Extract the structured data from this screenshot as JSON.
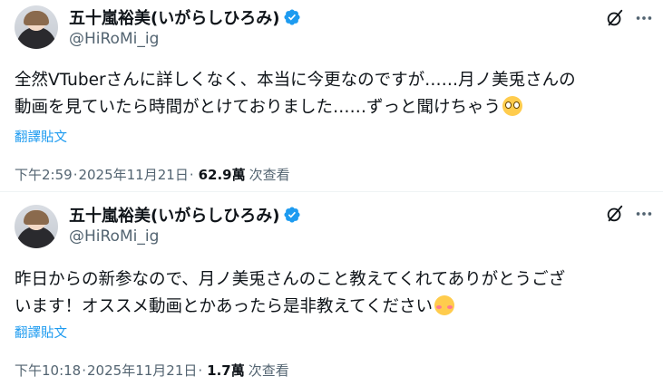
{
  "tweets": [
    {
      "author": {
        "display_name": "五十嵐裕美(いがらしひろみ)",
        "handle": "@HiRoMi_ig"
      },
      "text_lines": [
        "全然VTuberさんに詳しくなく、本当に今更なのですが……月ノ美兎さんの",
        "動画を見ていたら時間がとけておりました……ずっと聞けちゃう"
      ],
      "emoji": "pleading-face",
      "translate_label": "翻譯貼文",
      "time": "下午2:59",
      "date": "2025年11月21日",
      "dot": "·",
      "views_count": "62.9萬",
      "views_label": "次查看"
    },
    {
      "author": {
        "display_name": "五十嵐裕美(いがらしひろみ)",
        "handle": "@HiRoMi_ig"
      },
      "text_lines": [
        "昨日からの新参なので、月ノ美兎さんのこと教えてくれてありがとうござ",
        "います！オススメ動画とかあったら是非教えてください"
      ],
      "emoji": "smiling-face-with-blush",
      "translate_label": "翻譯貼文",
      "time": "下午10:18",
      "date": "2025年11月21日",
      "dot": "·",
      "views_count": "1.7萬",
      "views_label": "次查看"
    }
  ],
  "colors": {
    "verified": "#1d9bf0",
    "link": "#1d9bf0",
    "secondary_text": "#536471",
    "primary_text": "#0f1419",
    "divider": "#eff3f4"
  },
  "icons": [
    "verified-badge-icon",
    "grok-icon",
    "more-icon"
  ]
}
